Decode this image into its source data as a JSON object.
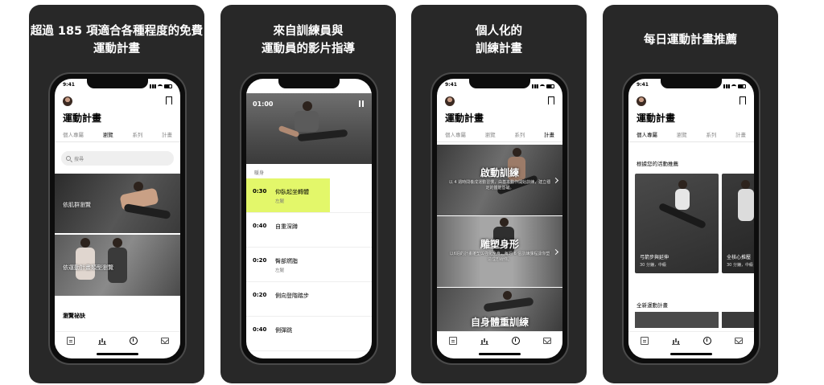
{
  "panels": [
    {
      "caption": [
        "超過 185 項適合各種程度的免費",
        "運動計畫"
      ],
      "screen": {
        "time": "9:41",
        "app_title": "運動計畫",
        "tabs": [
          "個人專屬",
          "瀏覽",
          "系列",
          "計畫"
        ],
        "active_tab": 1,
        "search_placeholder": "搜尋",
        "cards": [
          "依肌群瀏覽",
          "依運動計畫類型瀏覽"
        ],
        "footer_heading": "瀏覽祕訣"
      }
    },
    {
      "caption": [
        "來自訓練員與",
        "運動員的影片指導"
      ],
      "screen": {
        "video_time": "01:00",
        "section_label": "暖身",
        "exercises": [
          {
            "duration": "0:30",
            "name": "仰臥起坐轉體",
            "side": "左腿"
          },
          {
            "duration": "0:40",
            "name": "自重深蹲",
            "side": ""
          },
          {
            "duration": "0:20",
            "name": "臀部燃脂",
            "side": "左腿"
          },
          {
            "duration": "0:20",
            "name": "側向登階踏步",
            "side": ""
          },
          {
            "duration": "0:40",
            "name": "側彈跳",
            "side": ""
          }
        ]
      }
    },
    {
      "caption": [
        "個人化的",
        "訓練計畫"
      ],
      "screen": {
        "time": "9:41",
        "app_title": "運動計畫",
        "tabs": [
          "個人專屬",
          "瀏覽",
          "系列",
          "計畫"
        ],
        "active_tab": 3,
        "plans": [
          {
            "title": "啟動訓練",
            "desc": "以 4 週時間養成運動習慣，由基本動作開始訓練，建立穩定的體能基礎。"
          },
          {
            "title": "雕塑身形",
            "desc": "以6週的計畫雕塑與強化全身，每週 6 個訓練課程讓你塑造理想線條。"
          },
          {
            "title": "自身體重訓練",
            "desc": ""
          }
        ]
      }
    },
    {
      "caption": [
        "每日運動計畫推薦"
      ],
      "screen": {
        "time": "9:41",
        "app_title": "運動計畫",
        "tabs": [
          "個人專屬",
          "瀏覽",
          "系列",
          "計畫"
        ],
        "active_tab": 0,
        "rec_heading": "根據您的活動推薦",
        "recs": [
          {
            "name": "弓箭步與延伸",
            "meta": "30 分鐘，中級"
          },
          {
            "name": "全核心推壓",
            "meta": "30 分鐘，中級"
          }
        ],
        "new_heading": "全新運動計畫"
      }
    }
  ],
  "bottom_nav_icons": [
    "log-icon",
    "activity-chart-icon",
    "timer-icon",
    "inbox-icon"
  ],
  "colors": {
    "panel_bg": "#282828",
    "highlight": "#e3f76a",
    "text": "#000000"
  }
}
